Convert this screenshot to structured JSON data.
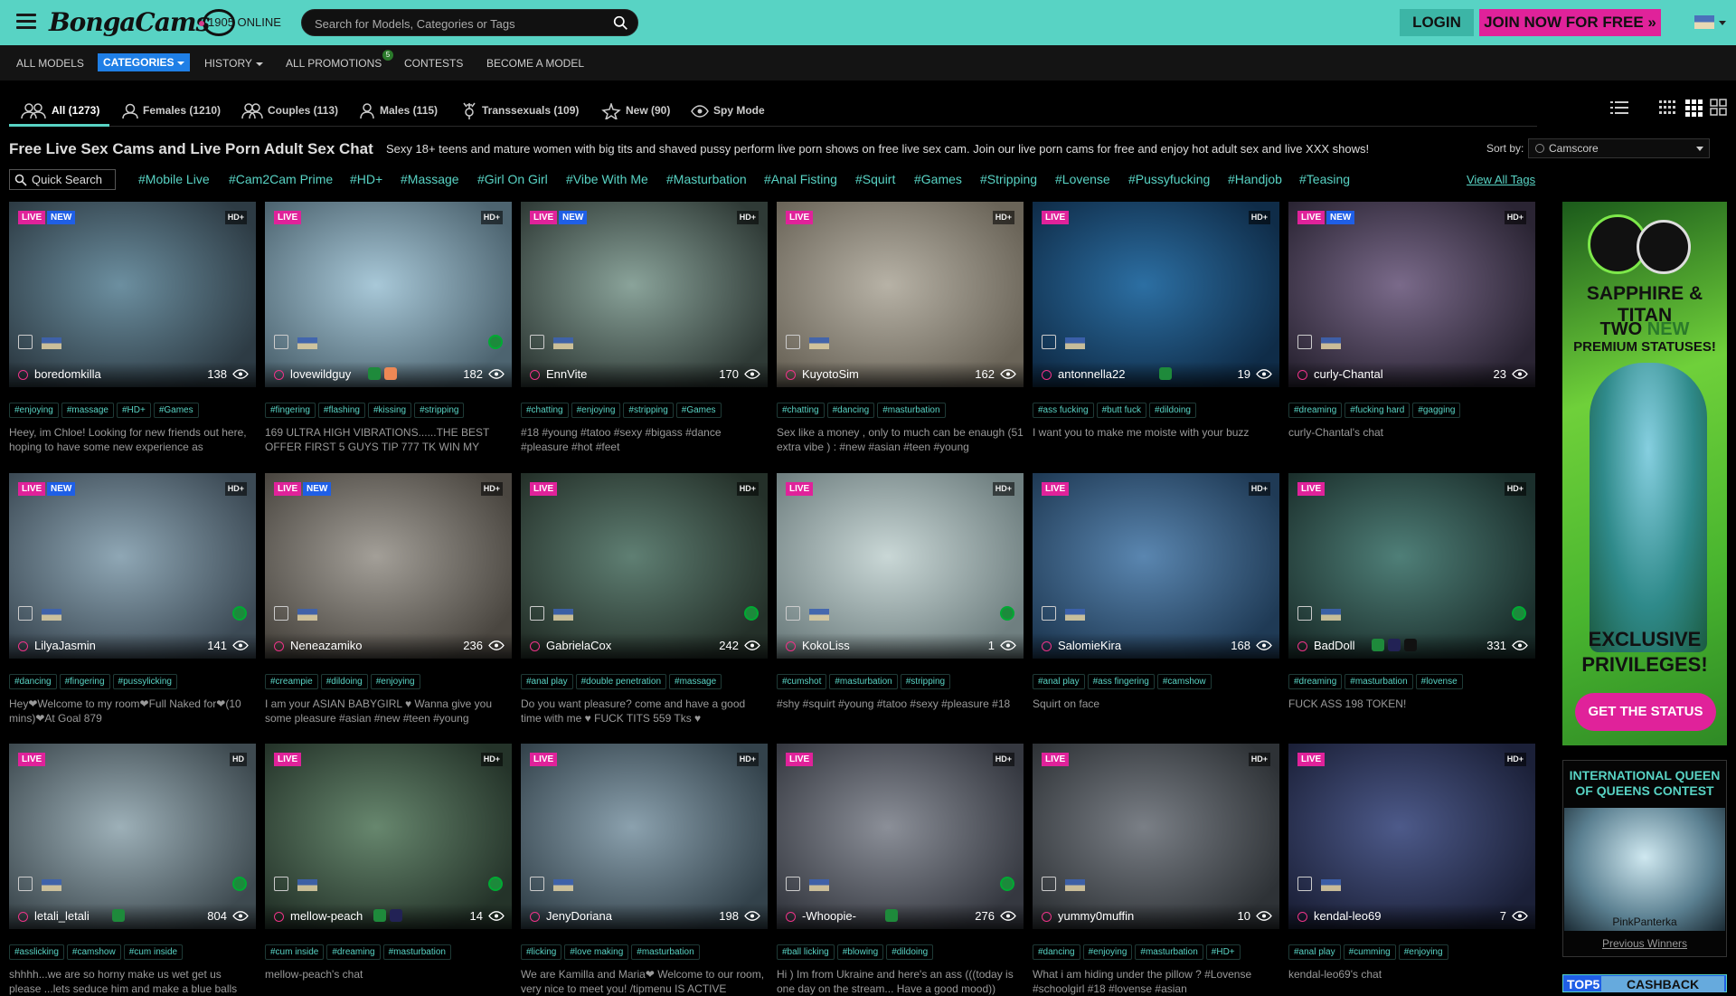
{
  "header": {
    "logo_text": "BongaCams",
    "online_text": "1905 ONLINE",
    "search_placeholder": "Search for Models, Categories or Tags",
    "login_label": "LOGIN",
    "join_label": "JOIN NOW FOR FREE »"
  },
  "nav": {
    "all_models": "ALL MODELS",
    "categories": "CATEGORIES",
    "history": "HISTORY",
    "all_promotions": "ALL PROMOTIONS",
    "promotions_badge": "5",
    "contests": "CONTESTS",
    "become_model": "BECOME A MODEL"
  },
  "tabs": [
    {
      "label": "All (1273)",
      "icon": "couple-icon"
    },
    {
      "label": "Females (1210)",
      "icon": "female-icon"
    },
    {
      "label": "Couples (113)",
      "icon": "couples-icon"
    },
    {
      "label": "Males (115)",
      "icon": "male-icon"
    },
    {
      "label": "Transsexuals (109)",
      "icon": "trans-icon"
    },
    {
      "label": "New (90)",
      "icon": "new-icon"
    },
    {
      "label": "Spy Mode",
      "icon": "eye-icon"
    }
  ],
  "heading": "Free Live Sex Cams and Live Porn Adult Sex Chat",
  "subheading": "Sexy 18+ teens and mature women with big tits and shaved pussy perform live porn shows on free live sex cam. Join our live porn cams for free and enjoy hot adult sex and live XXX shows!",
  "sort": {
    "label": "Sort by:",
    "value": "Camscore"
  },
  "quick_search": "Quick Search",
  "tag_links": [
    "#Mobile Live",
    "#Cam2Cam Prime",
    "#HD+",
    "#Massage",
    "#Girl On Girl",
    "#Vibe With Me",
    "#Masturbation",
    "#Anal Fisting",
    "#Squirt",
    "#Games",
    "#Stripping",
    "#Lovense",
    "#Pussyfucking",
    "#Handjob",
    "#Teasing"
  ],
  "view_all_tags": "View All Tags",
  "models": [
    {
      "name": "boredomkilla",
      "viewers": "138",
      "live": "LIVE",
      "new": "NEW",
      "hd": "HD+",
      "tags": [
        "#enjoying",
        "#massage",
        "#HD+",
        "#Games"
      ],
      "desc": "Heey, im Chloe! Looking for new friends out here, hoping to have some new experience as"
    },
    {
      "name": "lovewildguy",
      "viewers": "182",
      "live": "LIVE",
      "new": "",
      "hd": "HD+",
      "tags": [
        "#fingering",
        "#flashing",
        "#kissing",
        "#stripping"
      ],
      "desc": "169 ULTRA HIGH VIBRATIONS......THE BEST OFFER FIRST 5 GUYS TIP 777 TK WIN MY"
    },
    {
      "name": "EnnVite",
      "viewers": "170",
      "live": "LIVE",
      "new": "NEW",
      "hd": "HD+",
      "tags": [
        "#chatting",
        "#enjoying",
        "#stripping",
        "#Games"
      ],
      "desc": "#18 #young #tatoo #sexy #bigass #dance #pleasure #hot #feet"
    },
    {
      "name": "KuyotoSim",
      "viewers": "162",
      "live": "LIVE",
      "new": "",
      "hd": "HD+",
      "tags": [
        "#chatting",
        "#dancing",
        "#masturbation"
      ],
      "desc": "Sex like a money , only to much can be enaugh (51 extra vibe ) : #new #asian #teen #young"
    },
    {
      "name": "antonnella22",
      "viewers": "19",
      "live": "LIVE",
      "new": "",
      "hd": "HD+",
      "tags": [
        "#ass fucking",
        "#butt fuck",
        "#dildoing"
      ],
      "desc": "I want you to make me moiste with your buzz"
    },
    {
      "name": "curly-Chantal",
      "viewers": "23",
      "live": "LIVE",
      "new": "NEW",
      "hd": "HD+",
      "tags": [
        "#dreaming",
        "#fucking hard",
        "#gagging"
      ],
      "desc": "curly-Chantal's chat"
    },
    {
      "name": "LilyaJasmin",
      "viewers": "141",
      "live": "LIVE",
      "new": "NEW",
      "hd": "HD+",
      "tags": [
        "#dancing",
        "#fingering",
        "#pussylicking"
      ],
      "desc": "Hey❤Welcome to my room❤Full Naked for❤(10 mins)❤At Goal 879"
    },
    {
      "name": "Neneazamiko",
      "viewers": "236",
      "live": "LIVE",
      "new": "NEW",
      "hd": "HD+",
      "tags": [
        "#creampie",
        "#dildoing",
        "#enjoying"
      ],
      "desc": "I am your ASIAN BABYGIRL ♥ Wanna give you some pleasure #asian #new #teen #young"
    },
    {
      "name": "GabrielaCox",
      "viewers": "242",
      "live": "LIVE",
      "new": "",
      "hd": "HD+",
      "tags": [
        "#anal play",
        "#double penetration",
        "#massage"
      ],
      "desc": "Do you want pleasure? come and have a good time with me ♥ FUCK TITS 559 Tks ♥"
    },
    {
      "name": "KokoLiss",
      "viewers": "1",
      "live": "LIVE",
      "new": "",
      "hd": "HD+",
      "tags": [
        "#cumshot",
        "#masturbation",
        "#stripping"
      ],
      "desc": "#shy #squirt #young #tatoo #sexy #pleasure #18"
    },
    {
      "name": "SalomieKira",
      "viewers": "168",
      "live": "LIVE",
      "new": "",
      "hd": "HD+",
      "tags": [
        "#anal play",
        "#ass fingering",
        "#camshow"
      ],
      "desc": "Squirt on face"
    },
    {
      "name": "BadDoll",
      "viewers": "331",
      "live": "LIVE",
      "new": "",
      "hd": "HD+",
      "tags": [
        "#dreaming",
        "#masturbation",
        "#lovense"
      ],
      "desc": "FUCK ASS 198 TOKEN!"
    },
    {
      "name": "letali_letali",
      "viewers": "804",
      "live": "LIVE",
      "new": "",
      "hd": "HD",
      "tags": [
        "#asslicking",
        "#camshow",
        "#cum inside"
      ],
      "desc": "shhhh...we are so horny make us wet get us please ...lets seduce him and make a blue balls"
    },
    {
      "name": "mellow-peach",
      "viewers": "14",
      "live": "LIVE",
      "new": "",
      "hd": "HD+",
      "tags": [
        "#cum inside",
        "#dreaming",
        "#masturbation"
      ],
      "desc": "mellow-peach's chat"
    },
    {
      "name": "JenyDoriana",
      "viewers": "198",
      "live": "LIVE",
      "new": "",
      "hd": "HD+",
      "tags": [
        "#licking",
        "#love making",
        "#masturbation"
      ],
      "desc": "We are Kamilla and Maria❤ Welcome to our room, very nice to meet you! /tipmenu IS ACTIVE"
    },
    {
      "name": "-Whoopie-",
      "viewers": "276",
      "live": "LIVE",
      "new": "",
      "hd": "HD+",
      "tags": [
        "#ball licking",
        "#blowing",
        "#dildoing"
      ],
      "desc": "Hi ) Im from Ukraine and here's an ass (((today is one day on the stream... Have a good mood))"
    },
    {
      "name": "yummy0muffin",
      "viewers": "10",
      "live": "LIVE",
      "new": "",
      "hd": "HD+",
      "tags": [
        "#dancing",
        "#enjoying",
        "#masturbation",
        "#HD+"
      ],
      "desc": "What i am hiding under the pillow ? #Lovense #schoolgirl #18 #lovense #asian"
    },
    {
      "name": "kendal-leo69",
      "viewers": "7",
      "live": "LIVE",
      "new": "",
      "hd": "HD+",
      "tags": [
        "#anal play",
        "#cumming",
        "#enjoying"
      ],
      "desc": "kendal-leo69's chat"
    }
  ],
  "ad_status": {
    "line1": "SAPPHIRE & TITAN",
    "line2a": "TWO",
    "line2b": "NEW",
    "line3": "PREMIUM STATUSES!",
    "line4": "EXCLUSIVE",
    "line5": "PRIVILEGES!",
    "button": "GET THE STATUS"
  },
  "ad_contest": {
    "title": "INTERNATIONAL QUEEN OF QUEENS CONTEST",
    "winner": "PinkPanterka",
    "previous": "Previous Winners"
  },
  "ad_cashback": {
    "top": "TOP5",
    "label": "CASHBACK"
  },
  "colors": {
    "accent": "#58d3c4",
    "pink": "#e0229a",
    "blue": "#1f5fe6"
  }
}
